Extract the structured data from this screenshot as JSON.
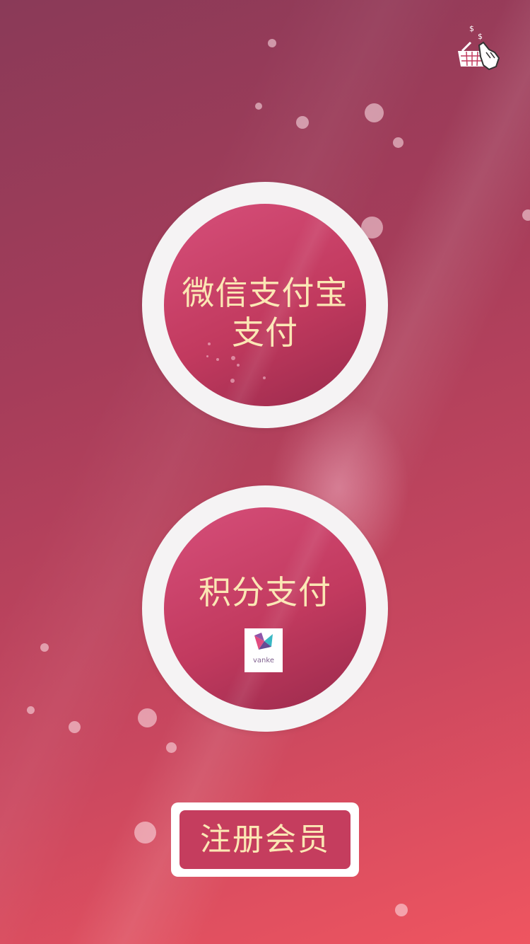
{
  "payment_options": [
    {
      "label": "微信支付宝\n支付"
    },
    {
      "label": "积分支付"
    }
  ],
  "partner_logo": {
    "text": "vanke"
  },
  "register": {
    "label": "注册会员"
  },
  "colors": {
    "background_top": "#8a3a58",
    "background_bottom": "#ef5560",
    "circle_fill": "#c23a5f",
    "ring": "#f5f3f4",
    "label_text": "#fbe7b4"
  },
  "icons": {
    "top_right": "shopping-basket-hand-icon"
  }
}
